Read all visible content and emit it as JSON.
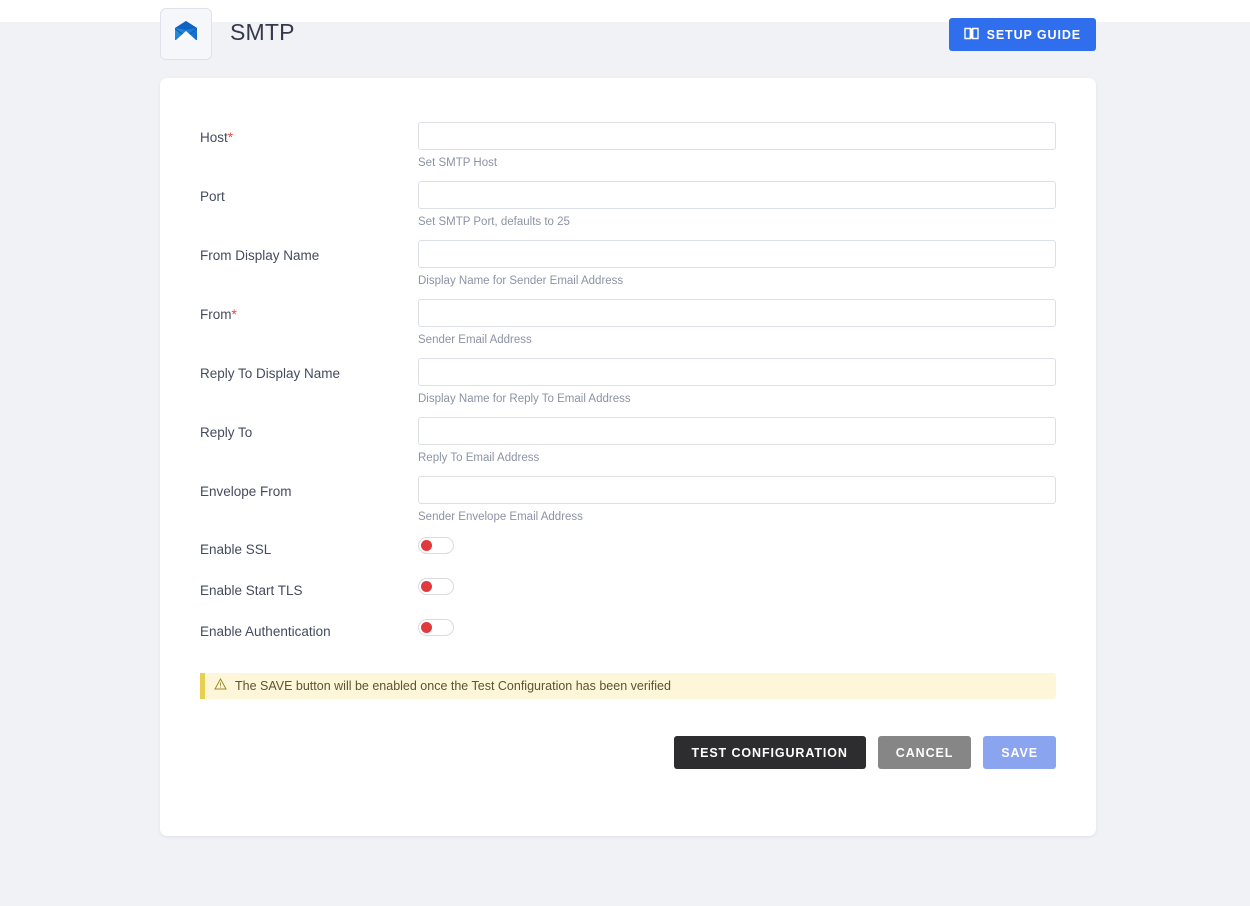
{
  "header": {
    "title": "SMTP",
    "app_icon": "envelope-icon",
    "setup_guide_label": "SETUP GUIDE",
    "setup_guide_icon": "book-icon",
    "accent_color": "#2f6fed"
  },
  "form": {
    "required_marker": "*",
    "fields": [
      {
        "label": "Host",
        "required": true,
        "value": "",
        "placeholder": "",
        "hint": "Set SMTP Host",
        "name": "host"
      },
      {
        "label": "Port",
        "required": false,
        "value": "",
        "placeholder": "",
        "hint": "Set SMTP Port, defaults to 25",
        "name": "port"
      },
      {
        "label": "From Display Name",
        "required": false,
        "value": "",
        "placeholder": "",
        "hint": "Display Name for Sender Email Address",
        "name": "from-display-name"
      },
      {
        "label": "From",
        "required": true,
        "value": "",
        "placeholder": "",
        "hint": "Sender Email Address",
        "name": "from"
      },
      {
        "label": "Reply To Display Name",
        "required": false,
        "value": "",
        "placeholder": "",
        "hint": "Display Name for Reply To Email Address",
        "name": "reply-to-display-name"
      },
      {
        "label": "Reply To",
        "required": false,
        "value": "",
        "placeholder": "",
        "hint": "Reply To Email Address",
        "name": "reply-to"
      },
      {
        "label": "Envelope From",
        "required": false,
        "value": "",
        "placeholder": "",
        "hint": "Sender Envelope Email Address",
        "name": "envelope-from"
      }
    ],
    "toggles": [
      {
        "label": "Enable SSL",
        "on": false,
        "name": "enable-ssl"
      },
      {
        "label": "Enable Start TLS",
        "on": false,
        "name": "enable-start-tls"
      },
      {
        "label": "Enable Authentication",
        "on": false,
        "name": "enable-authentication"
      }
    ],
    "toggle_off_color": "#e0393e"
  },
  "warning": {
    "icon": "warning-triangle-icon",
    "text": "The SAVE button will be enabled once the Test Configuration has been verified",
    "background": "#fdf6d8",
    "border_color": "#e8cf52"
  },
  "actions": {
    "test_label": "TEST CONFIGURATION",
    "cancel_label": "CANCEL",
    "save_label": "SAVE",
    "save_disabled": true
  }
}
